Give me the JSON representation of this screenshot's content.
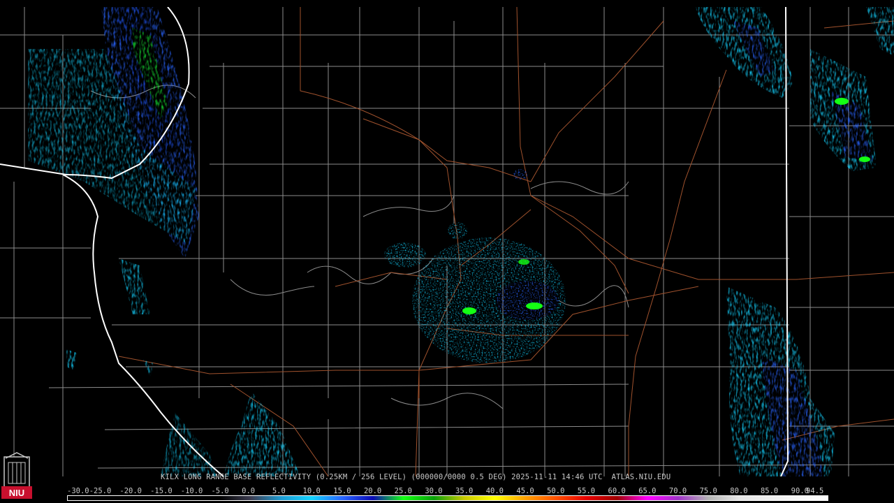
{
  "product": {
    "header": "KILX LONG RANGE BASE REFLECTIVITY (0.25KM / 256 LEVEL) (000000/0000 0.5 DEG) 2025-11-11 14:46 UTC  ATLAS.NIU.EDU"
  },
  "logo": {
    "text": "NIU",
    "color": "#c8102e"
  },
  "colors": {
    "background": "#000000",
    "county_lines": "#8c8c8c",
    "state_lines": "#ffffff",
    "roads": "#a0522d"
  },
  "colorbar": {
    "ticks": [
      "-30.0",
      "-25.0",
      "-20.0",
      "-15.0",
      "-10.0",
      "-5.0",
      "0.0",
      "5.0",
      "10.0",
      "15.0",
      "20.0",
      "25.0",
      "30.0",
      "35.0",
      "40.0",
      "45.0",
      "50.0",
      "55.0",
      "60.0",
      "65.0",
      "70.0",
      "75.0",
      "80.0",
      "85.0",
      "90.0",
      "94.5"
    ],
    "stops": [
      {
        "value": -30,
        "color": "#000000"
      },
      {
        "value": -5,
        "color": "#000000"
      },
      {
        "value": 0,
        "color": "#3c3c50"
      },
      {
        "value": 5,
        "color": "#1e9bd2"
      },
      {
        "value": 10,
        "color": "#14d2ff"
      },
      {
        "value": 15,
        "color": "#2864ff"
      },
      {
        "value": 20,
        "color": "#0a0ab4"
      },
      {
        "value": 25,
        "color": "#14ff14"
      },
      {
        "value": 30,
        "color": "#0aa00a"
      },
      {
        "value": 35,
        "color": "#c8c800"
      },
      {
        "value": 40,
        "color": "#ffff00"
      },
      {
        "value": 45,
        "color": "#ffa000"
      },
      {
        "value": 50,
        "color": "#ff5000"
      },
      {
        "value": 55,
        "color": "#e60000"
      },
      {
        "value": 60,
        "color": "#a00000"
      },
      {
        "value": 65,
        "color": "#ff00ff"
      },
      {
        "value": 70,
        "color": "#a032c8"
      },
      {
        "value": 75,
        "color": "#b4b4b4"
      },
      {
        "value": 80,
        "color": "#e6e6e6"
      },
      {
        "value": 94.5,
        "color": "#ffffff"
      }
    ]
  },
  "echo_regions": [
    {
      "name": "nw-band",
      "dominant_dbz": 15
    },
    {
      "name": "ne-bands",
      "dominant_dbz": 10
    },
    {
      "name": "se-band",
      "dominant_dbz": 15
    },
    {
      "name": "radar-clutter",
      "dominant_dbz": 10
    },
    {
      "name": "sw-patches",
      "dominant_dbz": 10
    }
  ]
}
